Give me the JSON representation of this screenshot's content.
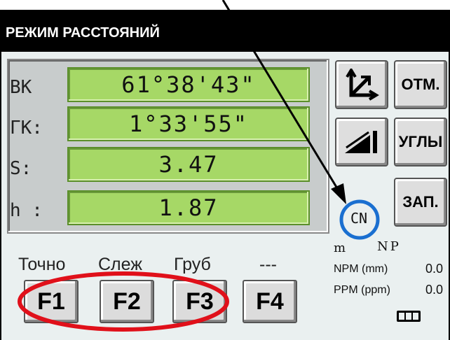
{
  "header": {
    "title": "РЕЖИМ РАССТОЯНИЙ"
  },
  "measurements": [
    {
      "label": "ВК",
      "value": "61°38'43\""
    },
    {
      "label": "ГК:",
      "value": "1°33'55\""
    },
    {
      "label": "S:",
      "value": "3.47"
    },
    {
      "label": "h :",
      "value": "1.87"
    }
  ],
  "side_buttons": {
    "coord_icon": "coordinate-axes-icon",
    "slope_icon": "slope-icon",
    "otm_label": "ОТМ.",
    "ugly_label": "УГЛЫ",
    "zap_label": "ЗАП."
  },
  "status": {
    "cn": "CN",
    "unit": "m",
    "np": "NP",
    "npm_label": "NPM (mm)",
    "npm_value": "0.0",
    "ppm_label": "PPM (ppm)",
    "ppm_value": "0.0",
    "battery_icon": "battery-icon"
  },
  "mode_labels": [
    "Точно",
    "Слеж",
    "Груб",
    "---"
  ],
  "function_keys": [
    "F1",
    "F2",
    "F3",
    "F4"
  ],
  "annotation_colors": {
    "arrow": "#000000",
    "circle_blue": "#1a6fd0",
    "ellipse_red": "#e0101a"
  }
}
